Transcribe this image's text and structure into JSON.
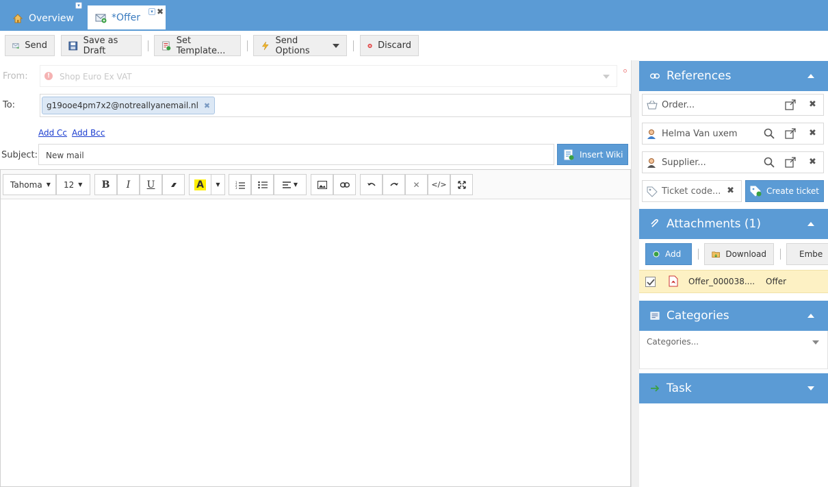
{
  "tabs": [
    {
      "label": "Overview"
    },
    {
      "label": "*Offer"
    }
  ],
  "toolbar": {
    "send": "Send",
    "save_draft": "Save as Draft",
    "set_template": "Set Template...",
    "send_options": "Send Options",
    "discard": "Discard"
  },
  "form": {
    "from_label": "From:",
    "from_value": "Shop Euro Ex VAT",
    "to_label": "To:",
    "to_recipient": "g19ooe4pm7x2@notreallyanemail.nl",
    "add_cc": "Add Cc",
    "add_bcc": "Add Bcc",
    "subject_label": "Subject:",
    "subject_value": "New mail",
    "insert_wiki": "Insert Wiki"
  },
  "editor": {
    "font_family": "Tahoma",
    "font_size": "12",
    "bold": "B",
    "italic": "I",
    "underline": "U",
    "font_color": "A"
  },
  "references": {
    "title": "References",
    "order_placeholder": "Order...",
    "contact": "Helma Van uxem",
    "supplier_placeholder": "Supplier...",
    "ticket_placeholder": "Ticket code...",
    "create_ticket": "Create ticket"
  },
  "attachments": {
    "title": "Attachments (1)",
    "add": "Add",
    "download": "Download",
    "embed": "Embe",
    "files": [
      {
        "name": "Offer_000038....",
        "type": "Offer"
      }
    ]
  },
  "categories": {
    "title": "Categories",
    "placeholder": "Categories..."
  },
  "task": {
    "title": "Task"
  },
  "colors": {
    "accent": "#5b9bd5",
    "attachment_highlight": "#fdf1c4"
  }
}
